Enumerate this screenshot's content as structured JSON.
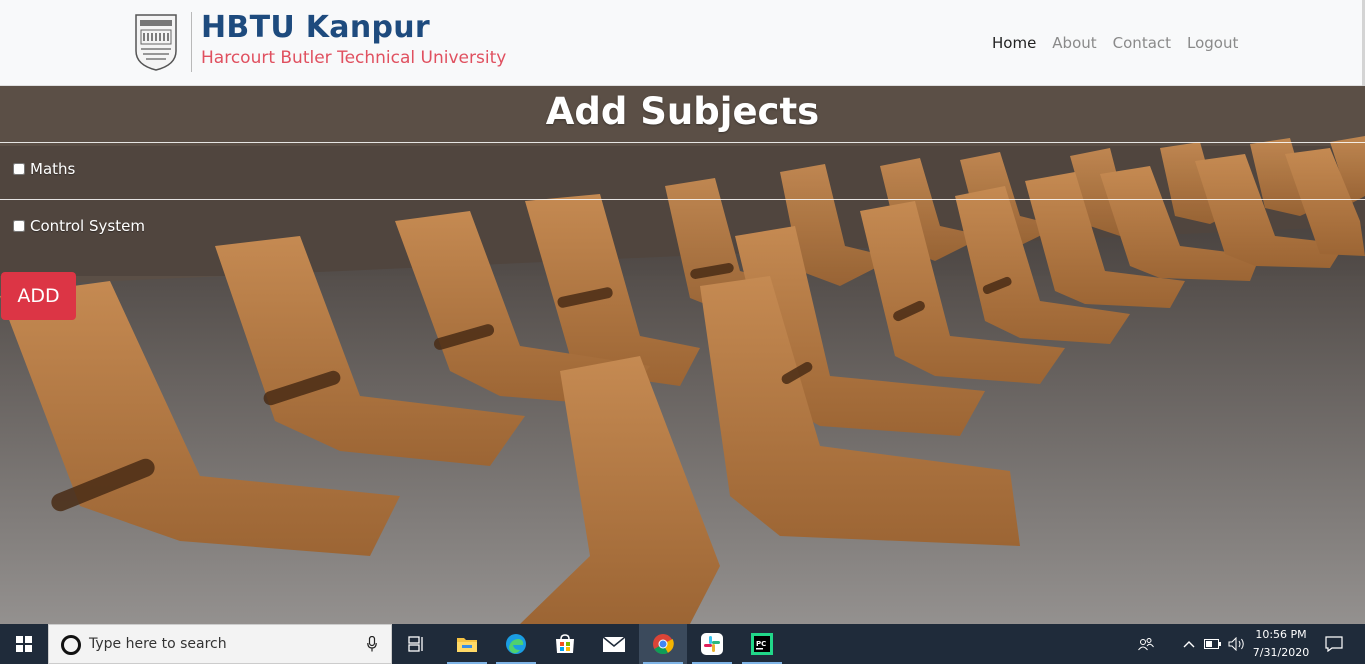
{
  "header": {
    "brand_title": "HBTU Kanpur",
    "brand_subtitle": "Harcourt Butler Technical  University",
    "nav": [
      {
        "label": "Home",
        "active": true
      },
      {
        "label": "About",
        "active": false
      },
      {
        "label": "Contact",
        "active": false
      },
      {
        "label": "Logout",
        "active": false
      }
    ]
  },
  "main": {
    "heading": "Add Subjects",
    "subjects": [
      {
        "label": "Maths",
        "checked": false
      },
      {
        "label": "Control System",
        "checked": false
      }
    ],
    "add_button": "ADD"
  },
  "taskbar": {
    "search_placeholder": "Type here to search",
    "apps": [
      "task-view",
      "file-explorer",
      "edge",
      "store",
      "mail",
      "chrome",
      "slack",
      "pycharm"
    ],
    "time": "10:56 PM",
    "date": "7/31/2020"
  },
  "colors": {
    "brand_blue": "#1e4b7e",
    "brand_red": "#e0505f",
    "add_button": "#dc3545",
    "taskbar": "#1f2b3a"
  }
}
